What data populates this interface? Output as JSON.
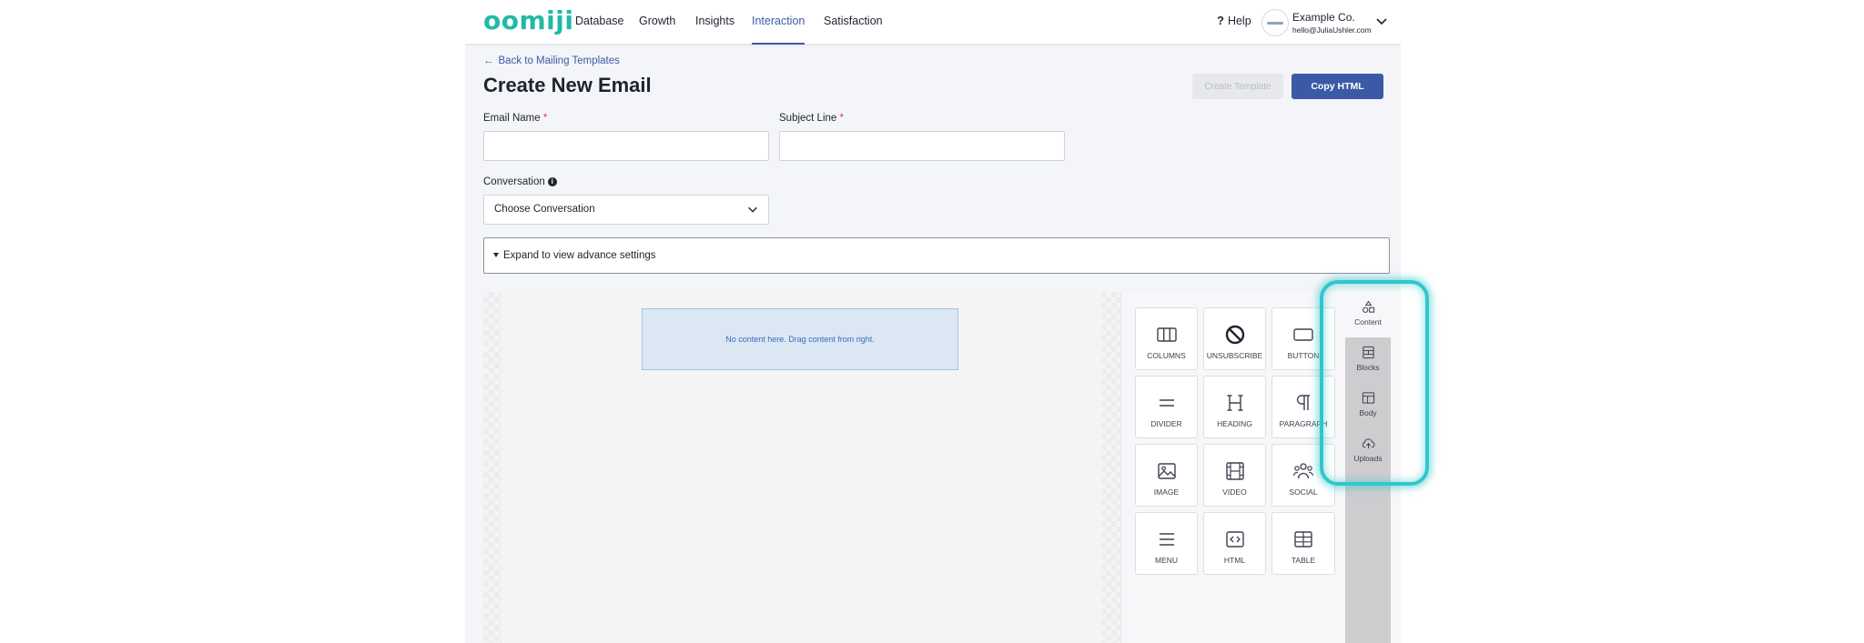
{
  "brand": {
    "logo_text": "oomiji",
    "logo_color": "#22b9a6",
    "accent": "#3b5aa6"
  },
  "nav": {
    "items": [
      {
        "label": "Database"
      },
      {
        "label": "Growth"
      },
      {
        "label": "Insights"
      },
      {
        "label": "Interaction",
        "active": true
      },
      {
        "label": "Satisfaction"
      }
    ],
    "help_label": "Help",
    "account_name": "Example Co.",
    "account_email": "hello@JuliaUshler.com"
  },
  "header": {
    "back_link": "Back to Mailing Templates",
    "title": "Create New Email",
    "create_template_label": "Create Template",
    "copy_html_label": "Copy HTML"
  },
  "form": {
    "email_name_label": "Email Name",
    "email_name_value": "",
    "subject_line_label": "Subject Line",
    "subject_line_value": "",
    "required_mark": "*",
    "conversation_label": "Conversation",
    "conversation_selected": "Choose Conversation",
    "advance_label": "Expand to view advance settings"
  },
  "editor": {
    "empty_message": "No content here. Drag content from right.",
    "tools": [
      {
        "label": "COLUMNS",
        "icon": "columns-icon"
      },
      {
        "label": "UNSUBSCRIBE",
        "icon": "unsubscribe-icon"
      },
      {
        "label": "BUTTON",
        "icon": "button-icon"
      },
      {
        "label": "DIVIDER",
        "icon": "divider-icon"
      },
      {
        "label": "HEADING",
        "icon": "heading-icon"
      },
      {
        "label": "PARAGRAPH",
        "icon": "paragraph-icon"
      },
      {
        "label": "IMAGE",
        "icon": "image-icon"
      },
      {
        "label": "VIDEO",
        "icon": "video-icon"
      },
      {
        "label": "SOCIAL",
        "icon": "social-icon"
      },
      {
        "label": "MENU",
        "icon": "menu-icon"
      },
      {
        "label": "HTML",
        "icon": "html-icon"
      },
      {
        "label": "TABLE",
        "icon": "table-icon"
      }
    ],
    "tabs": [
      {
        "label": "Content",
        "icon": "shapes-icon",
        "active": true
      },
      {
        "label": "Blocks",
        "icon": "blocks-icon"
      },
      {
        "label": "Body",
        "icon": "layout-icon"
      },
      {
        "label": "Uploads",
        "icon": "cloud-upload-icon"
      }
    ],
    "highlight_color": "#31c6cc"
  }
}
